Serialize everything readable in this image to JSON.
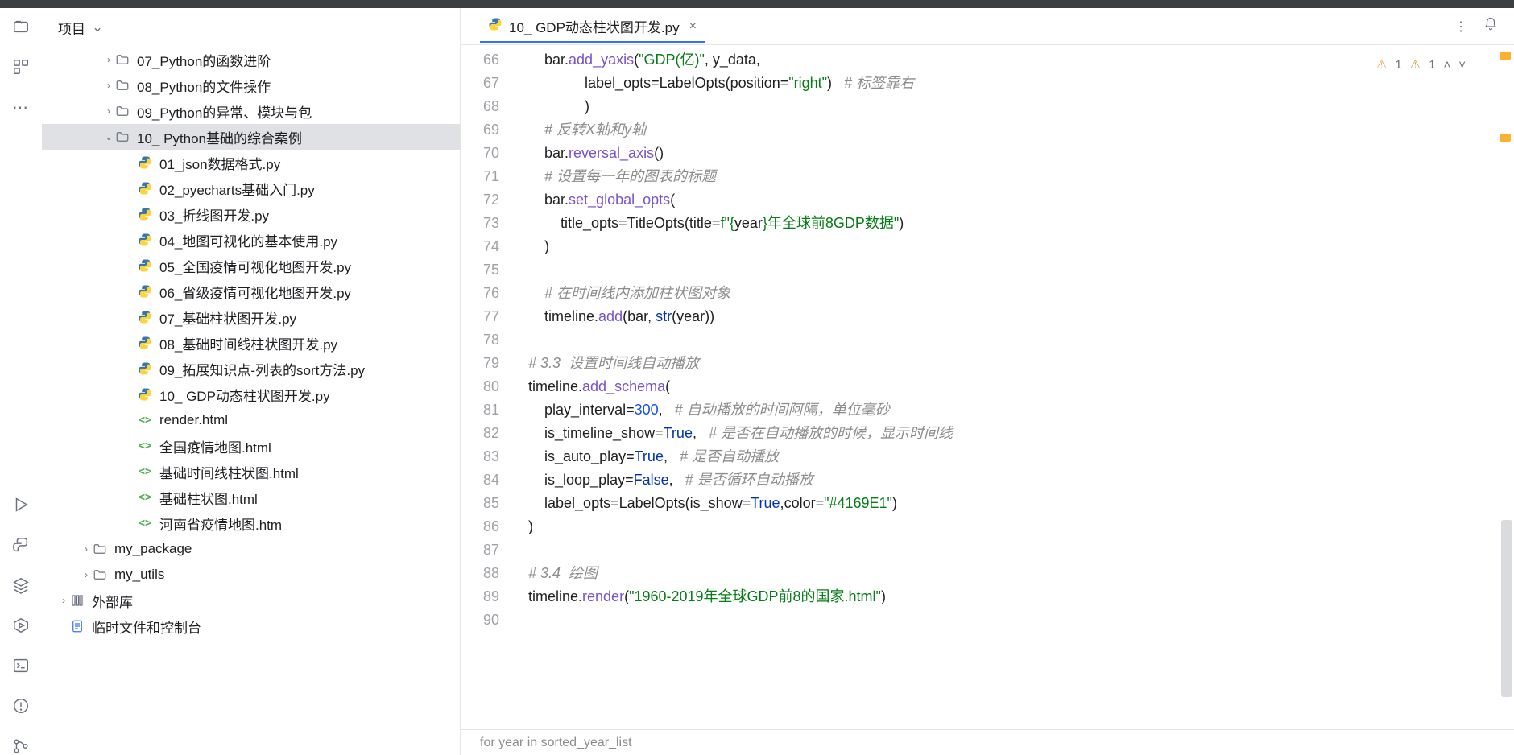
{
  "sidehead": {
    "label": "项目"
  },
  "tree": [
    {
      "depth": 2,
      "arrow": "right",
      "kind": "folder",
      "label": "07_Python的函数进阶"
    },
    {
      "depth": 2,
      "arrow": "right",
      "kind": "folder",
      "label": "08_Python的文件操作"
    },
    {
      "depth": 2,
      "arrow": "right",
      "kind": "folder",
      "label": "09_Python的异常、模块与包"
    },
    {
      "depth": 2,
      "arrow": "down",
      "kind": "folder",
      "label": "10_ Python基础的综合案例",
      "selected": true
    },
    {
      "depth": 3,
      "arrow": "",
      "kind": "py",
      "label": "01_json数据格式.py"
    },
    {
      "depth": 3,
      "arrow": "",
      "kind": "py",
      "label": "02_pyecharts基础入门.py"
    },
    {
      "depth": 3,
      "arrow": "",
      "kind": "py",
      "label": "03_折线图开发.py"
    },
    {
      "depth": 3,
      "arrow": "",
      "kind": "py",
      "label": "04_地图可视化的基本使用.py"
    },
    {
      "depth": 3,
      "arrow": "",
      "kind": "py",
      "label": "05_全国疫情可视化地图开发.py"
    },
    {
      "depth": 3,
      "arrow": "",
      "kind": "py",
      "label": "06_省级疫情可视化地图开发.py"
    },
    {
      "depth": 3,
      "arrow": "",
      "kind": "py",
      "label": "07_基础柱状图开发.py"
    },
    {
      "depth": 3,
      "arrow": "",
      "kind": "py",
      "label": "08_基础时间线柱状图开发.py"
    },
    {
      "depth": 3,
      "arrow": "",
      "kind": "py",
      "label": "09_拓展知识点-列表的sort方法.py"
    },
    {
      "depth": 3,
      "arrow": "",
      "kind": "py",
      "label": "10_ GDP动态柱状图开发.py"
    },
    {
      "depth": 3,
      "arrow": "",
      "kind": "html",
      "label": "render.html"
    },
    {
      "depth": 3,
      "arrow": "",
      "kind": "html",
      "label": "全国疫情地图.html"
    },
    {
      "depth": 3,
      "arrow": "",
      "kind": "html",
      "label": "基础时间线柱状图.html"
    },
    {
      "depth": 3,
      "arrow": "",
      "kind": "html",
      "label": "基础柱状图.html"
    },
    {
      "depth": 3,
      "arrow": "",
      "kind": "html",
      "label": "河南省疫情地图.htm"
    },
    {
      "depth": 1,
      "arrow": "right",
      "kind": "folder",
      "label": "my_package"
    },
    {
      "depth": 1,
      "arrow": "right",
      "kind": "folder",
      "label": "my_utils"
    },
    {
      "depth": 0,
      "arrow": "right",
      "kind": "lib",
      "label": "外部库"
    },
    {
      "depth": 0,
      "arrow": "",
      "kind": "scratch",
      "label": "临时文件和控制台"
    }
  ],
  "tab": {
    "label": "10_ GDP动态柱状图开发.py"
  },
  "inspect": {
    "w1": "1",
    "w2": "1"
  },
  "linestart": 66,
  "code": [
    {
      "tokens": [
        {
          "t": "plain",
          "v": "        bar."
        },
        {
          "t": "fn",
          "v": "add_yaxis"
        },
        {
          "t": "plain",
          "v": "("
        },
        {
          "t": "str",
          "v": "\"GDP(亿)\""
        },
        {
          "t": "plain",
          "v": ", y_data,"
        }
      ]
    },
    {
      "tokens": [
        {
          "t": "plain",
          "v": "                  "
        },
        {
          "t": "par",
          "v": "label_opts"
        },
        {
          "t": "plain",
          "v": "=LabelOpts("
        },
        {
          "t": "par",
          "v": "position"
        },
        {
          "t": "plain",
          "v": "="
        },
        {
          "t": "str",
          "v": "\"right\""
        },
        {
          "t": "plain",
          "v": ")   "
        },
        {
          "t": "cmt",
          "v": "# 标签靠右"
        }
      ]
    },
    {
      "tokens": [
        {
          "t": "plain",
          "v": "                  )"
        }
      ]
    },
    {
      "tokens": [
        {
          "t": "plain",
          "v": "        "
        },
        {
          "t": "cmt",
          "v": "# 反转X轴和y轴"
        }
      ]
    },
    {
      "tokens": [
        {
          "t": "plain",
          "v": "        bar."
        },
        {
          "t": "fn",
          "v": "reversal_axis"
        },
        {
          "t": "plain",
          "v": "()"
        }
      ]
    },
    {
      "tokens": [
        {
          "t": "plain",
          "v": "        "
        },
        {
          "t": "cmt",
          "v": "# 设置每一年的图表的标题"
        }
      ]
    },
    {
      "tokens": [
        {
          "t": "plain",
          "v": "        bar."
        },
        {
          "t": "fn",
          "v": "set_global_opts"
        },
        {
          "t": "plain",
          "v": "("
        }
      ]
    },
    {
      "tokens": [
        {
          "t": "plain",
          "v": "            "
        },
        {
          "t": "par",
          "v": "title_opts"
        },
        {
          "t": "plain",
          "v": "=TitleOpts("
        },
        {
          "t": "par",
          "v": "title"
        },
        {
          "t": "plain",
          "v": "="
        },
        {
          "t": "str",
          "v": "f\"{"
        },
        {
          "t": "plain",
          "v": "year"
        },
        {
          "t": "str",
          "v": "}年全球前8GDP数据\""
        },
        {
          "t": "plain",
          "v": ")"
        }
      ]
    },
    {
      "tokens": [
        {
          "t": "plain",
          "v": "        )"
        }
      ]
    },
    {
      "tokens": [
        {
          "t": "plain",
          "v": ""
        }
      ]
    },
    {
      "tokens": [
        {
          "t": "plain",
          "v": "        "
        },
        {
          "t": "cmt",
          "v": "# 在时间线内添加柱状图对象"
        }
      ]
    },
    {
      "tokens": [
        {
          "t": "plain",
          "v": "        timeline."
        },
        {
          "t": "fn",
          "v": "add"
        },
        {
          "t": "plain",
          "v": "(bar, "
        },
        {
          "t": "kw",
          "v": "str"
        },
        {
          "t": "plain",
          "v": "(year))"
        }
      ],
      "caret": true,
      "caretPad": "               "
    },
    {
      "tokens": [
        {
          "t": "plain",
          "v": ""
        }
      ]
    },
    {
      "tokens": [
        {
          "t": "plain",
          "v": "    "
        },
        {
          "t": "cmt",
          "v": "# 3.3  设置时间线自动播放"
        }
      ]
    },
    {
      "tokens": [
        {
          "t": "plain",
          "v": "    timeline."
        },
        {
          "t": "fn",
          "v": "add_schema"
        },
        {
          "t": "plain",
          "v": "("
        }
      ]
    },
    {
      "tokens": [
        {
          "t": "plain",
          "v": "        "
        },
        {
          "t": "par",
          "v": "play_interval"
        },
        {
          "t": "plain",
          "v": "="
        },
        {
          "t": "num",
          "v": "300"
        },
        {
          "t": "plain",
          "v": ",   "
        },
        {
          "t": "cmt",
          "v": "# 自动播放的时间阿隔，单位毫砂"
        }
      ]
    },
    {
      "tokens": [
        {
          "t": "plain",
          "v": "        "
        },
        {
          "t": "par",
          "v": "is_timeline_show"
        },
        {
          "t": "plain",
          "v": "="
        },
        {
          "t": "kw",
          "v": "True"
        },
        {
          "t": "plain",
          "v": ",   "
        },
        {
          "t": "cmt",
          "v": "# 是否在自动播放的时候，显示时间线"
        }
      ]
    },
    {
      "tokens": [
        {
          "t": "plain",
          "v": "        "
        },
        {
          "t": "par",
          "v": "is_auto_play"
        },
        {
          "t": "plain",
          "v": "="
        },
        {
          "t": "kw",
          "v": "True"
        },
        {
          "t": "plain",
          "v": ",   "
        },
        {
          "t": "cmt",
          "v": "# 是否自动播放"
        }
      ]
    },
    {
      "tokens": [
        {
          "t": "plain",
          "v": "        "
        },
        {
          "t": "par",
          "v": "is_loop_play"
        },
        {
          "t": "plain",
          "v": "="
        },
        {
          "t": "kw",
          "v": "False"
        },
        {
          "t": "plain",
          "v": ",   "
        },
        {
          "t": "cmt",
          "v": "# 是否循环自动播放"
        }
      ]
    },
    {
      "tokens": [
        {
          "t": "plain",
          "v": "        "
        },
        {
          "t": "par",
          "v": "label_opts"
        },
        {
          "t": "plain",
          "v": "=LabelOpts("
        },
        {
          "t": "par",
          "v": "is_show"
        },
        {
          "t": "plain",
          "v": "="
        },
        {
          "t": "kw",
          "v": "True"
        },
        {
          "t": "plain",
          "v": ","
        },
        {
          "t": "par",
          "v": "color"
        },
        {
          "t": "plain",
          "v": "="
        },
        {
          "t": "str",
          "v": "\"#4169E1\""
        },
        {
          "t": "plain",
          "v": ")"
        }
      ]
    },
    {
      "tokens": [
        {
          "t": "plain",
          "v": "    )"
        }
      ]
    },
    {
      "tokens": [
        {
          "t": "plain",
          "v": ""
        }
      ]
    },
    {
      "tokens": [
        {
          "t": "plain",
          "v": "    "
        },
        {
          "t": "cmt",
          "v": "# 3.4  绘图"
        }
      ]
    },
    {
      "tokens": [
        {
          "t": "plain",
          "v": "    timeline."
        },
        {
          "t": "fn",
          "v": "render"
        },
        {
          "t": "plain",
          "v": "("
        },
        {
          "t": "str",
          "v": "\"1960-2019年全球GDP前8的国家.html\""
        },
        {
          "t": "plain",
          "v": ")"
        }
      ]
    },
    {
      "tokens": [
        {
          "t": "plain",
          "v": ""
        }
      ]
    }
  ],
  "breadcrumb": "for year in sorted_year_list"
}
